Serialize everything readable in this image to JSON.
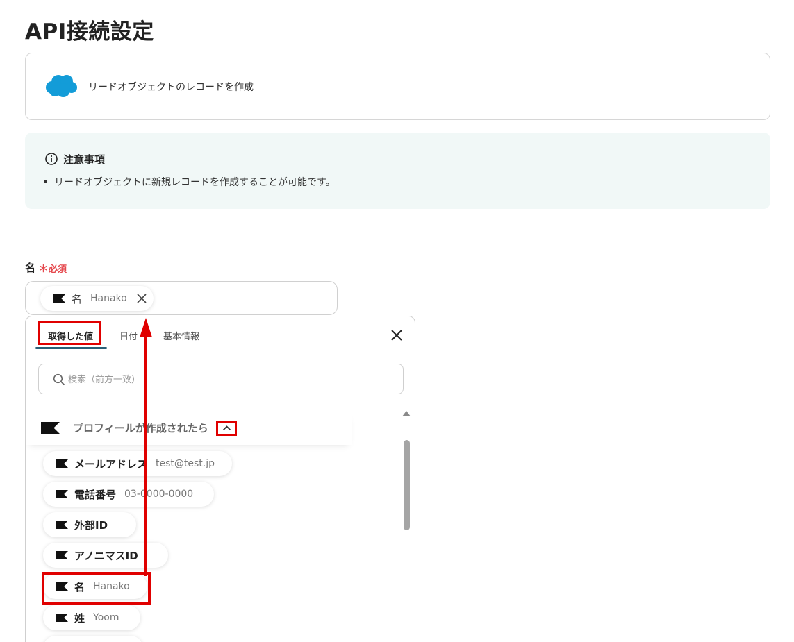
{
  "page": {
    "title": "API接続設定"
  },
  "app_card": {
    "action": "リードオブジェクトのレコードを作成",
    "brand_color": "#139cd8"
  },
  "notice": {
    "title": "注意事項",
    "items": [
      "リードオブジェクトに新規レコードを作成することが可能です。"
    ]
  },
  "field": {
    "label": "名",
    "required_mark": "＊",
    "required_label": "必須",
    "value_chip": {
      "name": "名",
      "value": "Hanako"
    }
  },
  "dropdown": {
    "tabs": [
      {
        "label": "取得した値",
        "active": true
      },
      {
        "label": "日付",
        "active": false
      },
      {
        "label": "基本情報",
        "active": false
      }
    ],
    "search_placeholder": "検索（前方一致）",
    "group": {
      "title": "プロフィールが作成されたら",
      "items": [
        {
          "name": "メールアドレス",
          "value": "test@test.jp"
        },
        {
          "name": "電話番号",
          "value": "03-0000-0000"
        },
        {
          "name": "外部ID",
          "value": ""
        },
        {
          "name": "アノニマスID",
          "value": ""
        },
        {
          "name": "名",
          "value": "Hanako"
        },
        {
          "name": "姓",
          "value": "Yoom"
        }
      ]
    }
  },
  "colors": {
    "highlight": "#e00000",
    "accent": "#2a5f77",
    "required": "#e5484d",
    "notice_bg": "#f1f8f7"
  }
}
